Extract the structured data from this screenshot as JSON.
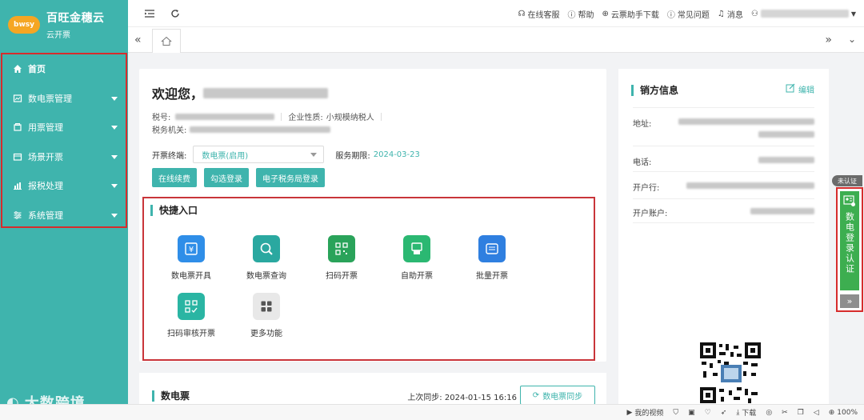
{
  "brand": {
    "logo": "bwsy",
    "name": "百旺金穗云",
    "sub": "云开票"
  },
  "sidebar": {
    "items": [
      {
        "label": "首页",
        "icon": "home-icon",
        "active": true
      },
      {
        "label": "数电票管理",
        "icon": "invoice-icon"
      },
      {
        "label": "用票管理",
        "icon": "ticket-icon"
      },
      {
        "label": "场景开票",
        "icon": "scene-icon"
      },
      {
        "label": "报税处理",
        "icon": "tax-icon"
      },
      {
        "label": "系统管理",
        "icon": "settings-icon"
      }
    ]
  },
  "topbar": {
    "links": [
      "在线客服",
      "帮助",
      "云票助手下载",
      "常见问题",
      "消息"
    ]
  },
  "welcome": {
    "greeting": "欢迎您，",
    "tax_no_label": "税号:",
    "enterprise_type_label": "企业性质:",
    "enterprise_type": "小规模纳税人",
    "tax_office_label": "税务机关:",
    "terminal_label": "开票终端:",
    "terminal_value": "数电票(启用)",
    "service_label": "服务期限:",
    "service_value": "2024-03-23",
    "buttons": [
      "在线续费",
      "勾选登录",
      "电子税务局登录"
    ]
  },
  "quick": {
    "title": "快捷入口",
    "items": [
      {
        "label": "数电票开具",
        "color": "#2f8ee8",
        "icon": "yuan-invoice-icon"
      },
      {
        "label": "数电票查询",
        "color": "#2aa8a0",
        "icon": "search-invoice-icon"
      },
      {
        "label": "扫码开票",
        "color": "#2aa35a",
        "icon": "qrcode-icon"
      },
      {
        "label": "自助开票",
        "color": "#2bb872",
        "icon": "self-service-icon"
      },
      {
        "label": "批量开票",
        "color": "#2f7fe0",
        "icon": "batch-icon"
      },
      {
        "label": "扫码审核开票",
        "color": "#2ab5a3",
        "icon": "scan-review-icon"
      },
      {
        "label": "更多功能",
        "color": "#e8e8e8",
        "icon": "grid-icon"
      }
    ]
  },
  "bottom": {
    "title": "数电票",
    "sync_label": "上次同步:",
    "sync_time": "2024-01-15 16:16",
    "sync_button": "数电票同步"
  },
  "seller": {
    "title": "销方信息",
    "edit": "编辑",
    "rows": [
      "地址:",
      "电话:",
      "开户行:",
      "开户账户:"
    ]
  },
  "auth": {
    "badge": "未认证",
    "label": "数电登录认证",
    "arrow": "»"
  },
  "statusbar": {
    "video": "我的视频",
    "download": "下载",
    "zoom": "100%"
  },
  "watermark": "大数跨境"
}
